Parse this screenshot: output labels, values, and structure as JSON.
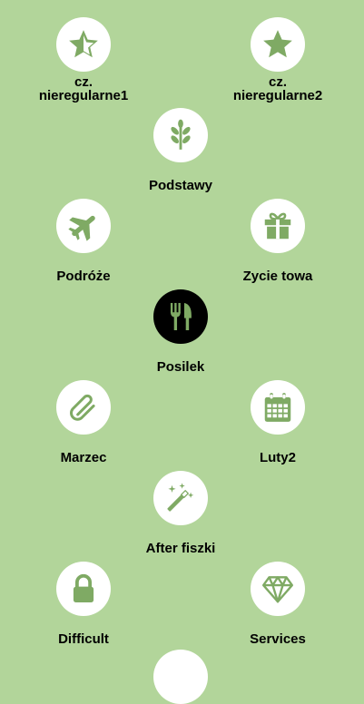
{
  "colors": {
    "background": "#b2d59a",
    "icon_green": "#7faa64",
    "circle": "#ffffff",
    "circle_selected": "#000000"
  },
  "tiles": [
    {
      "label": "cz.\nnieregularne1",
      "icon": "star-half-icon"
    },
    {
      "label": "cz.\nnieregularne2",
      "icon": "star-icon"
    },
    {
      "label": "Podstawy",
      "icon": "leaf-icon"
    },
    {
      "label": "Podróże",
      "icon": "airplane-icon"
    },
    {
      "label": "Zycie towa",
      "icon": "gift-icon"
    },
    {
      "label": "Posilek",
      "icon": "utensils-icon",
      "selected": true
    },
    {
      "label": "Marzec",
      "icon": "paperclip-icon"
    },
    {
      "label": "Luty2",
      "icon": "calendar-icon"
    },
    {
      "label": "After fiszki",
      "icon": "magic-wand-icon"
    },
    {
      "label": "Difficult",
      "icon": "lock-icon"
    },
    {
      "label": "Services",
      "icon": "diamond-icon"
    }
  ]
}
